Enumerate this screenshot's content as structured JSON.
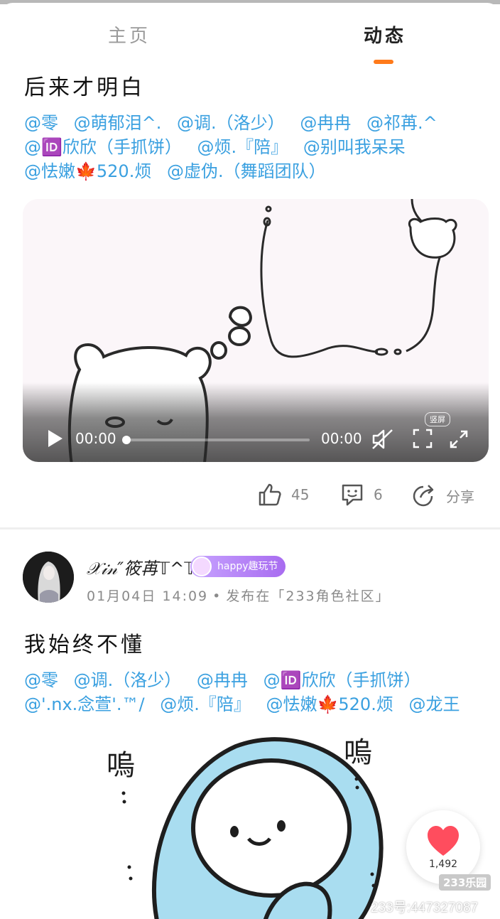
{
  "tabs": [
    {
      "label": "主页",
      "active": false
    },
    {
      "label": "动态",
      "active": true
    }
  ],
  "accent_color": "#ff7a1a",
  "mention_color": "#3aa0e0",
  "post1": {
    "title": "后来才明白",
    "mentions": [
      "@零",
      "@萌郁泪^.",
      "@调.（洛少）",
      "@冉冉",
      "@祁苒.^",
      "@🆔欣欣（手抓饼）",
      "@烦.『陪』",
      "@别叫我呆呆",
      "@怯嫩🍁520.烦",
      "@虚伪.（舞蹈团队）"
    ],
    "video": {
      "current_time": "00:00",
      "total_time": "00:00",
      "progress": 0,
      "vertical_label": "竖屏"
    },
    "likes": "45",
    "comments": "6",
    "share_label": "分享"
  },
  "post2": {
    "username": "𝒳𝒾𝓃″筱苒𝕋^𝕋",
    "badge": "happy趣玩节",
    "time": "01月04日 14:09",
    "published_in": "发布在「233角色社区」",
    "title": "我始终不懂",
    "mentions": [
      "@零",
      "@调.（洛少）",
      "@冉冉",
      "@🆔欣欣（手抓饼）",
      "@'.nx.念萱'.™/",
      "@烦.『陪』",
      "@怯嫩🍁520.烦",
      "@龙王"
    ]
  },
  "fab": {
    "count": "1,492"
  },
  "watermark": {
    "logo": "233乐园",
    "text": "233号:447327087"
  }
}
